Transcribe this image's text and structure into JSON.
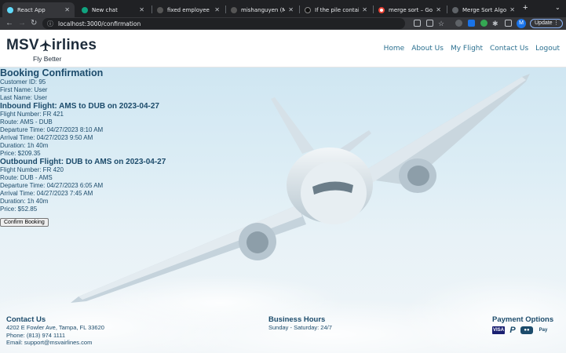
{
  "browser": {
    "tabs": [
      {
        "title": "React App",
        "active": true,
        "color": "#61dafb"
      },
      {
        "title": "New chat",
        "active": false,
        "color": "#10a37f"
      },
      {
        "title": "fixed employee view...",
        "active": false,
        "color": "#444"
      },
      {
        "title": "mishanguyen (Misha...",
        "active": false,
        "color": "#444"
      },
      {
        "title": "If the pile contains on...",
        "active": false,
        "color": "#000"
      },
      {
        "title": "merge sort – Google...",
        "active": false,
        "color": "#ea4335"
      },
      {
        "title": "Merge Sort Algorithm...",
        "active": false,
        "color": "#5f6368"
      }
    ],
    "url": "localhost:3000/confirmation",
    "profile_initial": "M",
    "update_label": "Update"
  },
  "site": {
    "logo_text_left": "MSV",
    "logo_text_right": "irlines",
    "tagline": "Fly Better",
    "nav": [
      "Home",
      "About Us",
      "My Flight",
      "Contact Us",
      "Logout"
    ]
  },
  "booking": {
    "title": "Booking Confirmation",
    "customer_id": "Customer ID: 95",
    "first_name": "First Name: User",
    "last_name": "Last Name: User",
    "inbound": {
      "heading": "Inbound Flight: AMS to DUB on 2023-04-27",
      "flight_number": "Flight Number: FR 421",
      "route": "Route: AMS - DUB",
      "departure": "Departure Time: 04/27/2023 8:10 AM",
      "arrival": "Arrival Time: 04/27/2023 9:50 AM",
      "duration": "Duration: 1h 40m",
      "price": "Price: $209.35"
    },
    "outbound": {
      "heading": "Outbound Flight: DUB to AMS on 2023-04-27",
      "flight_number": "Flight Number: FR 420",
      "route": "Route: DUB - AMS",
      "departure": "Departure Time: 04/27/2023 6:05 AM",
      "arrival": "Arrival Time: 04/27/2023 7:45 AM",
      "duration": "Duration: 1h 40m",
      "price": "Price: $52.85"
    },
    "confirm_label": "Confirm Booking"
  },
  "footer": {
    "contact": {
      "heading": "Contact Us",
      "address": "4202 E Fowler Ave, Tampa, FL 33620",
      "phone": "Phone: (813) 974 1111",
      "email": "Email: support@msvairlines.com"
    },
    "hours": {
      "heading": "Business Hours",
      "text": "Sunday - Saturday: 24/7"
    },
    "payment": {
      "heading": "Payment Options",
      "methods": [
        "VISA",
        "PayPal",
        "MasterCard",
        "Apple Pay"
      ]
    }
  }
}
